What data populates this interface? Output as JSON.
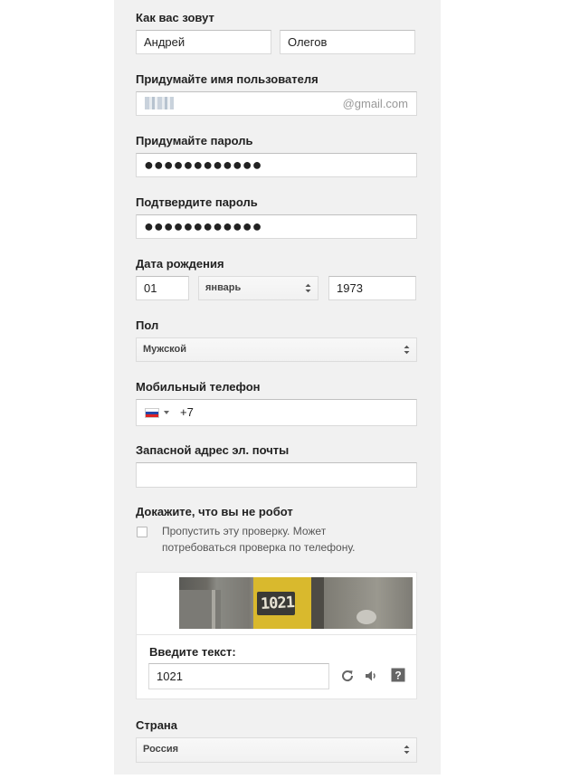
{
  "form": {
    "name": {
      "label": "Как вас зовут",
      "first_value": "Андрей",
      "last_value": "Олегов"
    },
    "username": {
      "label": "Придумайте имя пользователя",
      "suffix": "@gmail.com"
    },
    "password": {
      "label": "Придумайте пароль",
      "value": "●●●●●●●●●●●●"
    },
    "confirm_password": {
      "label": "Подтвердите пароль",
      "value": "●●●●●●●●●●●●"
    },
    "birthdate": {
      "label": "Дата рождения",
      "day": "01",
      "month": "январь",
      "year": "1973"
    },
    "gender": {
      "label": "Пол",
      "value": "Мужской"
    },
    "phone": {
      "label": "Мобильный телефон",
      "code": "+7"
    },
    "recovery_email": {
      "label": "Запасной адрес эл. почты",
      "value": ""
    },
    "robot": {
      "label": "Докажите, что вы не робот",
      "skip_text": "Пропустить эту проверку. Может потребоваться проверка по телефону.",
      "captcha_image_text": "1021",
      "enter_text_label": "Введите текст:",
      "captcha_value": "1021"
    },
    "country": {
      "label": "Страна",
      "value": "Россия"
    }
  },
  "colors": {
    "panel_bg": "#f1f1f1",
    "input_border": "#d9d9d9",
    "placeholder_gray": "#999999"
  }
}
